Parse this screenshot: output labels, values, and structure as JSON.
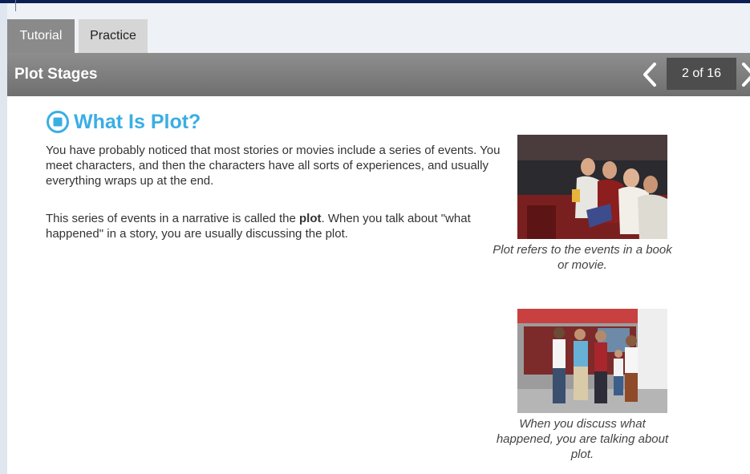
{
  "tabs": [
    {
      "label": "Tutorial",
      "active": true
    },
    {
      "label": "Practice",
      "active": false
    }
  ],
  "lesson": {
    "title": "Plot Stages",
    "page_counter": "2 of 16"
  },
  "section": {
    "heading": "What Is Plot?",
    "paragraphs": [
      "You have probably noticed that most stories or movies include a series of events. You meet characters, and then the characters have all sorts of experiences, and usually everything wraps up at the end."
    ],
    "para2_before": "This series of events in a narrative is called the ",
    "para2_bold": "plot",
    "para2_after": ". When you talk about \"what happened\" in a story, you are usually discussing the plot."
  },
  "figures": [
    {
      "icon": "movie-audience-photo",
      "caption": "Plot refers to the events in a book or movie."
    },
    {
      "icon": "people-talking-photo",
      "caption": "When you discuss what happened, you are talking about plot."
    }
  ],
  "colors": {
    "top_bar": "#0c1f55",
    "heading": "#3aaee3",
    "lesson_bar": "#7d7d7d",
    "active_tab": "#8a8a8a",
    "inactive_tab": "#d6d6d6"
  }
}
